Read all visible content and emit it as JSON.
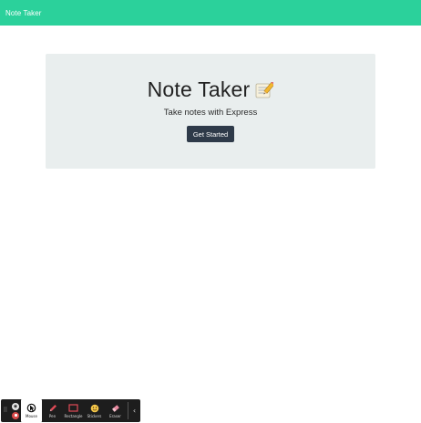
{
  "navbar": {
    "brand": "Note Taker"
  },
  "hero": {
    "title": "Note Taker",
    "title_icon": "memo-emoji-icon",
    "subtitle": "Take notes with Express",
    "cta_label": "Get Started"
  },
  "toolbar": {
    "grip_icon": "drag-grip-icon",
    "mini_buttons": [
      "camera-toggle-icon",
      "record-stop-icon"
    ],
    "tools": [
      {
        "label": "Mouse",
        "icon": "mouse-pointer-icon",
        "active": true
      },
      {
        "label": "Pen",
        "icon": "pen-icon",
        "active": false
      },
      {
        "label": "Rectangle",
        "icon": "rectangle-icon",
        "active": false
      },
      {
        "label": "Stickers",
        "icon": "sticker-icon",
        "active": false
      },
      {
        "label": "Eraser",
        "icon": "eraser-icon",
        "active": false
      }
    ],
    "collapse_icon": "chevron-left-icon"
  },
  "colors": {
    "navbar_bg": "#2bd19b",
    "hero_bg": "#e9eeee",
    "button_bg": "#2e3a49",
    "toolbar_bg": "#1d1d1d",
    "accent_red": "#d84a4a"
  }
}
